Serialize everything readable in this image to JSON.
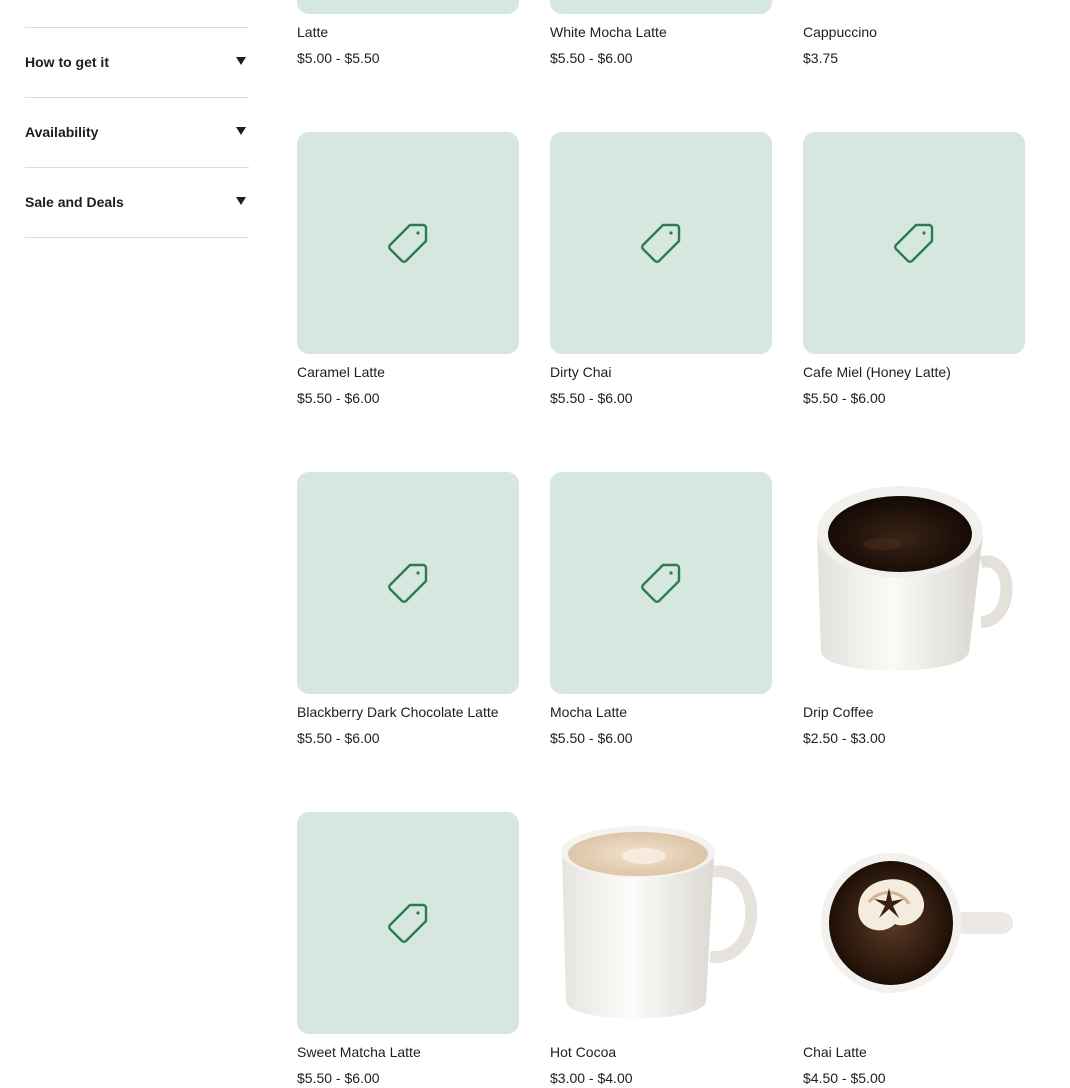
{
  "sidebar": {
    "filters": [
      {
        "label": "How to get it"
      },
      {
        "label": "Availability"
      },
      {
        "label": "Sale and Deals"
      }
    ]
  },
  "products": [
    {
      "name": "Latte",
      "price": "$5.00 - $5.50",
      "image": "tag-icon"
    },
    {
      "name": "White Mocha Latte",
      "price": "$5.50 - $6.00",
      "image": "tag-icon"
    },
    {
      "name": "Cappuccino",
      "price": "$3.75",
      "image": "product-photo"
    },
    {
      "name": "Caramel Latte",
      "price": "$5.50 - $6.00",
      "image": "tag-icon"
    },
    {
      "name": "Dirty Chai",
      "price": "$5.50 - $6.00",
      "image": "tag-icon"
    },
    {
      "name": "Cafe Miel (Honey Latte)",
      "price": "$5.50 - $6.00",
      "image": "tag-icon"
    },
    {
      "name": "Blackberry Dark Chocolate Latte",
      "price": "$5.50 - $6.00",
      "image": "tag-icon"
    },
    {
      "name": "Mocha Latte",
      "price": "$5.50 - $6.00",
      "image": "tag-icon"
    },
    {
      "name": "Drip Coffee",
      "price": "$2.50 - $3.00",
      "image": "drip-coffee-photo"
    },
    {
      "name": "Sweet Matcha Latte",
      "price": "$5.50 - $6.00",
      "image": "tag-icon"
    },
    {
      "name": "Hot Cocoa",
      "price": "$3.00 - $4.00",
      "image": "hot-cocoa-photo"
    },
    {
      "name": "Chai Latte",
      "price": "$4.50 - $5.00",
      "image": "chai-latte-photo"
    }
  ],
  "colors": {
    "placeholder_bg": "#d5e7df",
    "tag_icon": "#2e7a55",
    "text": "#1e1e1e",
    "divider": "#dcdcdc"
  }
}
